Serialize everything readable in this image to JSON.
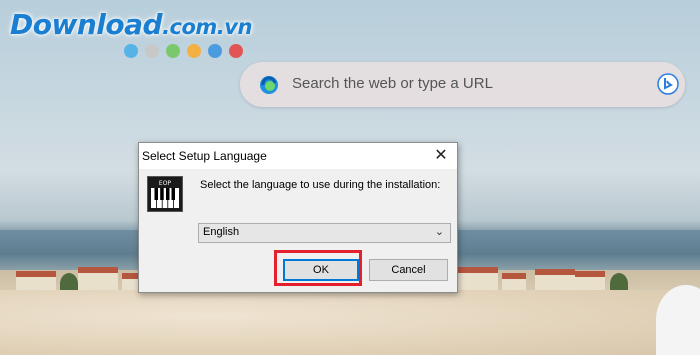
{
  "logo": {
    "brand": "Download",
    "domain": ".com.vn",
    "dot_colors": [
      "#56b3e8",
      "#c8c8c8",
      "#7bc86c",
      "#f3b043",
      "#4a9be0",
      "#e25555"
    ]
  },
  "search": {
    "placeholder": "Search the web or type a URL",
    "leading_icon": "edge-icon",
    "trailing_icon": "bing-icon"
  },
  "dialog": {
    "title": "Select Setup Language",
    "close_symbol": "✕",
    "prompt": "Select the language to use during the installation:",
    "language": {
      "selected": "English"
    },
    "buttons": {
      "ok": "OK",
      "cancel": "Cancel"
    },
    "app_icon": "piano-keys-icon",
    "app_icon_label": "EOP"
  },
  "colors": {
    "highlight": "#e3202b",
    "focus": "#0078d7"
  }
}
